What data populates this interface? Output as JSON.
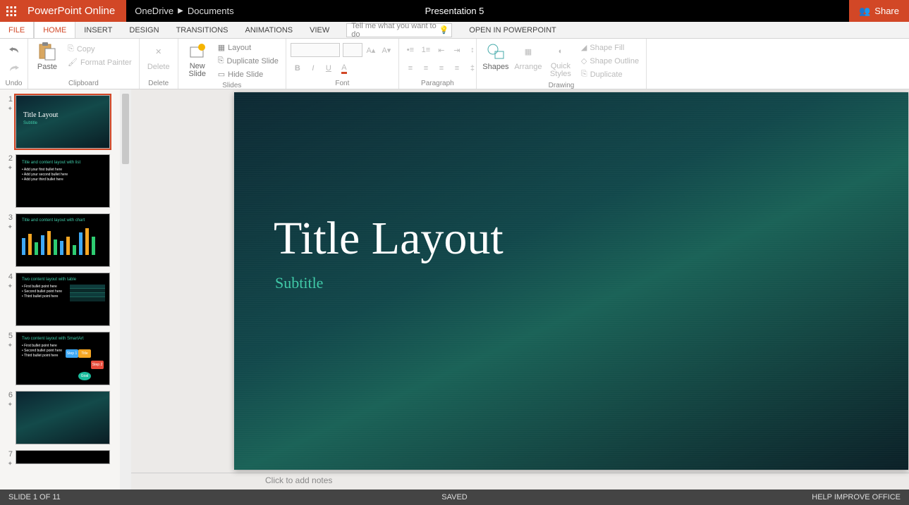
{
  "app": {
    "name": "PowerPoint Online"
  },
  "breadcrumb": {
    "root": "OneDrive",
    "folder": "Documents"
  },
  "document": {
    "title": "Presentation 5"
  },
  "share": {
    "label": "Share"
  },
  "tabs": {
    "file": "FILE",
    "home": "HOME",
    "insert": "INSERT",
    "design": "DESIGN",
    "transitions": "TRANSITIONS",
    "animations": "ANIMATIONS",
    "view": "VIEW",
    "tellme_placeholder": "Tell me what you want to do",
    "open_in_pp": "OPEN IN POWERPOINT"
  },
  "ribbon": {
    "undo": {
      "label": "Undo"
    },
    "clipboard": {
      "label": "Clipboard",
      "paste": "Paste",
      "copy": "Copy",
      "format_painter": "Format Painter"
    },
    "delete": {
      "label": "Delete",
      "btn": "Delete"
    },
    "slides": {
      "label": "Slides",
      "new_slide": "New Slide",
      "layout": "Layout",
      "duplicate": "Duplicate Slide",
      "hide": "Hide Slide"
    },
    "font": {
      "label": "Font"
    },
    "paragraph": {
      "label": "Paragraph"
    },
    "drawing": {
      "label": "Drawing",
      "shapes": "Shapes",
      "arrange": "Arrange",
      "quick_styles": "Quick Styles",
      "shape_fill": "Shape Fill",
      "shape_outline": "Shape Outline",
      "duplicate": "Duplicate"
    }
  },
  "slide": {
    "title": "Title Layout",
    "subtitle": "Subtitle"
  },
  "thumbnails": [
    {
      "num": "1",
      "kind": "title",
      "title": "Title Layout",
      "sub": "Subtitle"
    },
    {
      "num": "2",
      "kind": "bullets",
      "heading": "Title and content layout with list"
    },
    {
      "num": "3",
      "kind": "chart",
      "heading": "Title and content layout with chart"
    },
    {
      "num": "4",
      "kind": "table",
      "heading": "Two content layout with table"
    },
    {
      "num": "5",
      "kind": "smartart",
      "heading": "Two content layout with SmartArt"
    },
    {
      "num": "6",
      "kind": "blank"
    },
    {
      "num": "7",
      "kind": "blank"
    }
  ],
  "notes": {
    "placeholder": "Click to add notes"
  },
  "status": {
    "slide": "SLIDE 1 OF 11",
    "saved": "SAVED",
    "help": "HELP IMPROVE OFFICE"
  }
}
